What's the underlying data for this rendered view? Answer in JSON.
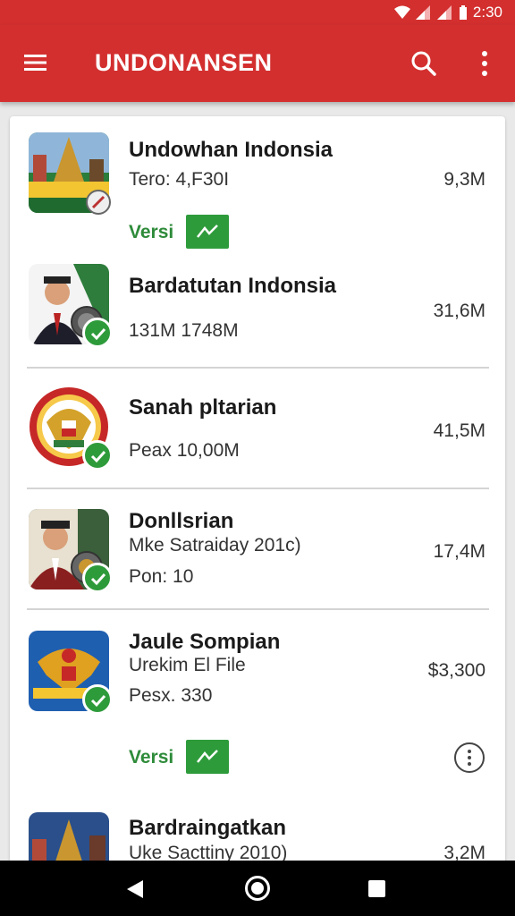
{
  "status_bar": {
    "time": "2:30"
  },
  "app_bar": {
    "title": "UNDONANSEN",
    "menu_icon": "hamburger-menu-icon",
    "search_icon": "search-icon",
    "more_icon": "more-vert-icon"
  },
  "colors": {
    "primary": "#d32f2f",
    "accent_green": "#2e9b3b",
    "text_green": "#2e8b3a"
  },
  "items": [
    {
      "name": "Undowhan Indonsia",
      "sub1": "Tero: 4,F30I",
      "size": "9,3M",
      "versi_label": "Versi",
      "verified": false
    },
    {
      "name": "Bardatutan Indonsia",
      "sub1": "131M 1748M",
      "size": "31,6M",
      "verified": true
    },
    {
      "name": "Sanah  pltarian",
      "sub1": "Peax 10,00M",
      "size": "41,5M",
      "verified": true
    },
    {
      "name": "Donllsrian",
      "sub1": "Mke Satraiday 201c)",
      "sub2": "Pon: 10",
      "size": "17,4M",
      "verified": true
    },
    {
      "name": "Jaule Sompian",
      "sub1": "Urekim El File",
      "sub2": "Pesx. 330",
      "size": "$3,300",
      "versi_label": "Versi",
      "verified": true
    },
    {
      "name": "Bardraingatkan",
      "sub1": "Uke Sacttiny 2010)",
      "size": "3,2M",
      "verified": false
    }
  ],
  "nav": {
    "back_icon": "back-triangle-icon",
    "home_icon": "home-circle-icon",
    "recents_icon": "recents-square-icon"
  }
}
